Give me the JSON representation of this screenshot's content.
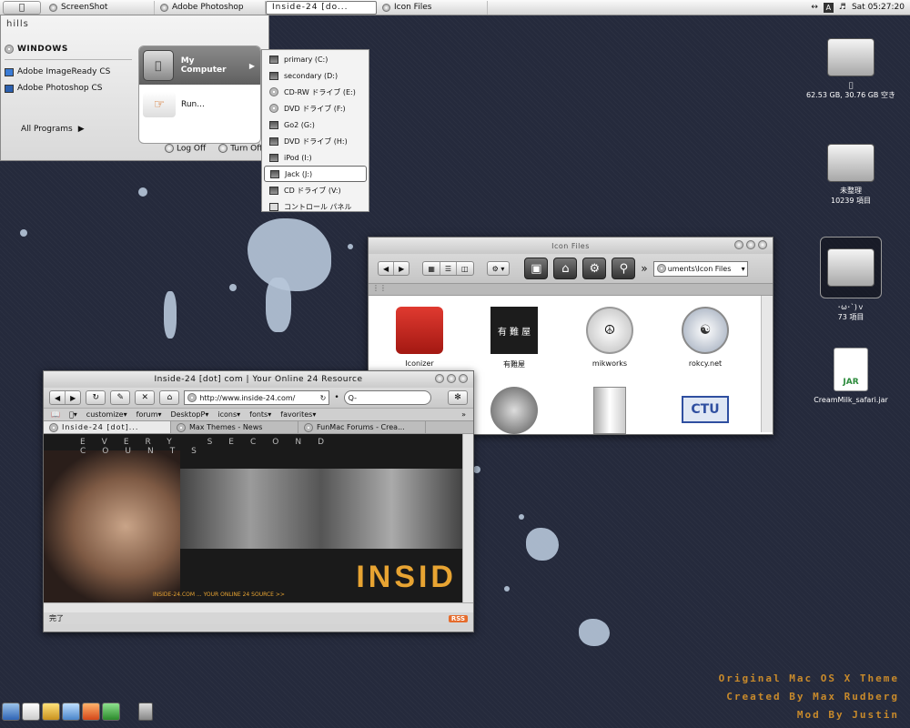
{
  "taskbar": {
    "tasks": [
      {
        "label": "ScreenShot",
        "active": false
      },
      {
        "label": "Adobe Photoshop",
        "active": false
      },
      {
        "label": "Inside-24 [do...",
        "active": true
      },
      {
        "label": "Icon Files",
        "active": false
      }
    ],
    "tray_letter": "A",
    "clock": "Sat 05:27:20"
  },
  "start_menu": {
    "username": "hills",
    "pinned": [
      {
        "label": "WINDOWS"
      },
      {
        "label": "Adobe ImageReady CS"
      },
      {
        "label": "Adobe Photoshop CS"
      }
    ],
    "all_programs": "All Programs",
    "my_computer": "My Computer",
    "run": "Run...",
    "log_off": "Log Off",
    "turn_off": "Turn Off"
  },
  "drives_menu": {
    "items": [
      {
        "label": "primary (C:)",
        "kind": "hd"
      },
      {
        "label": "secondary (D:)",
        "kind": "hd"
      },
      {
        "label": "CD-RW ドライブ (E:)",
        "kind": "cd"
      },
      {
        "label": "DVD ドライブ (F:)",
        "kind": "cd"
      },
      {
        "label": "Go2 (G:)",
        "kind": "hd"
      },
      {
        "label": "DVD ドライブ (H:)",
        "kind": "hd"
      },
      {
        "label": "iPod (I:)",
        "kind": "hd"
      },
      {
        "label": "Jack (J:)",
        "kind": "hd",
        "selected": true
      },
      {
        "label": "CD ドライブ (V:)",
        "kind": "hd"
      },
      {
        "label": "コントロール パネル",
        "kind": "panel"
      }
    ]
  },
  "icon_window": {
    "title": "Icon Files",
    "path": "uments\\Icon Files",
    "icons": [
      {
        "label": "Iconizer"
      },
      {
        "label": "有難屋"
      },
      {
        "label": "mikworks"
      },
      {
        "label": "rokcy.net"
      },
      {
        "label": ""
      },
      {
        "label": ""
      },
      {
        "label": ""
      },
      {
        "label": ""
      }
    ],
    "artwork_text": {
      "sign": "有 難 屋",
      "logo": "CTU"
    }
  },
  "browser": {
    "title": "Inside-24 [dot] com   | Your Online 24 Resource",
    "url": "http://www.inside-24.com/",
    "search_placeholder": "Q-",
    "bookmarks": [
      "customize",
      "forum",
      "DesktopP",
      "icons",
      "fonts",
      "favorites"
    ],
    "tabs": [
      {
        "label": "Inside-24 [dot]...",
        "active": true
      },
      {
        "label": "Max Themes - News",
        "active": false
      },
      {
        "label": "FunMac Forums - Crea...",
        "active": false
      }
    ],
    "content": {
      "tagline_top": "EVERY SECOND COUNTS",
      "banner": "INSID",
      "footer": "INSIDE-24.COM ... YOUR ONLINE 24 SOURCE >>"
    },
    "status": "完了",
    "rss": "RSS"
  },
  "desktop": {
    "icons": [
      {
        "label": "62.53 GB, 30.76 GB 空き"
      },
      {
        "label_line1": "未整理",
        "label_line2": "10239 項目"
      },
      {
        "label_line1": "･ω･`)ｖ",
        "label_line2": "73 項目"
      },
      {
        "label": "CreamMilk_safari.jar",
        "badge": "JAR"
      }
    ]
  },
  "credits": [
    "Original Mac OS X Theme",
    "Created By Max Rudberg",
    "Mod By Justin"
  ],
  "colors": {
    "desktop_bg": "#252a3c",
    "splatter": "#b7c7d9",
    "credits": "#c88a2b",
    "banner_text": "#e8a432"
  }
}
